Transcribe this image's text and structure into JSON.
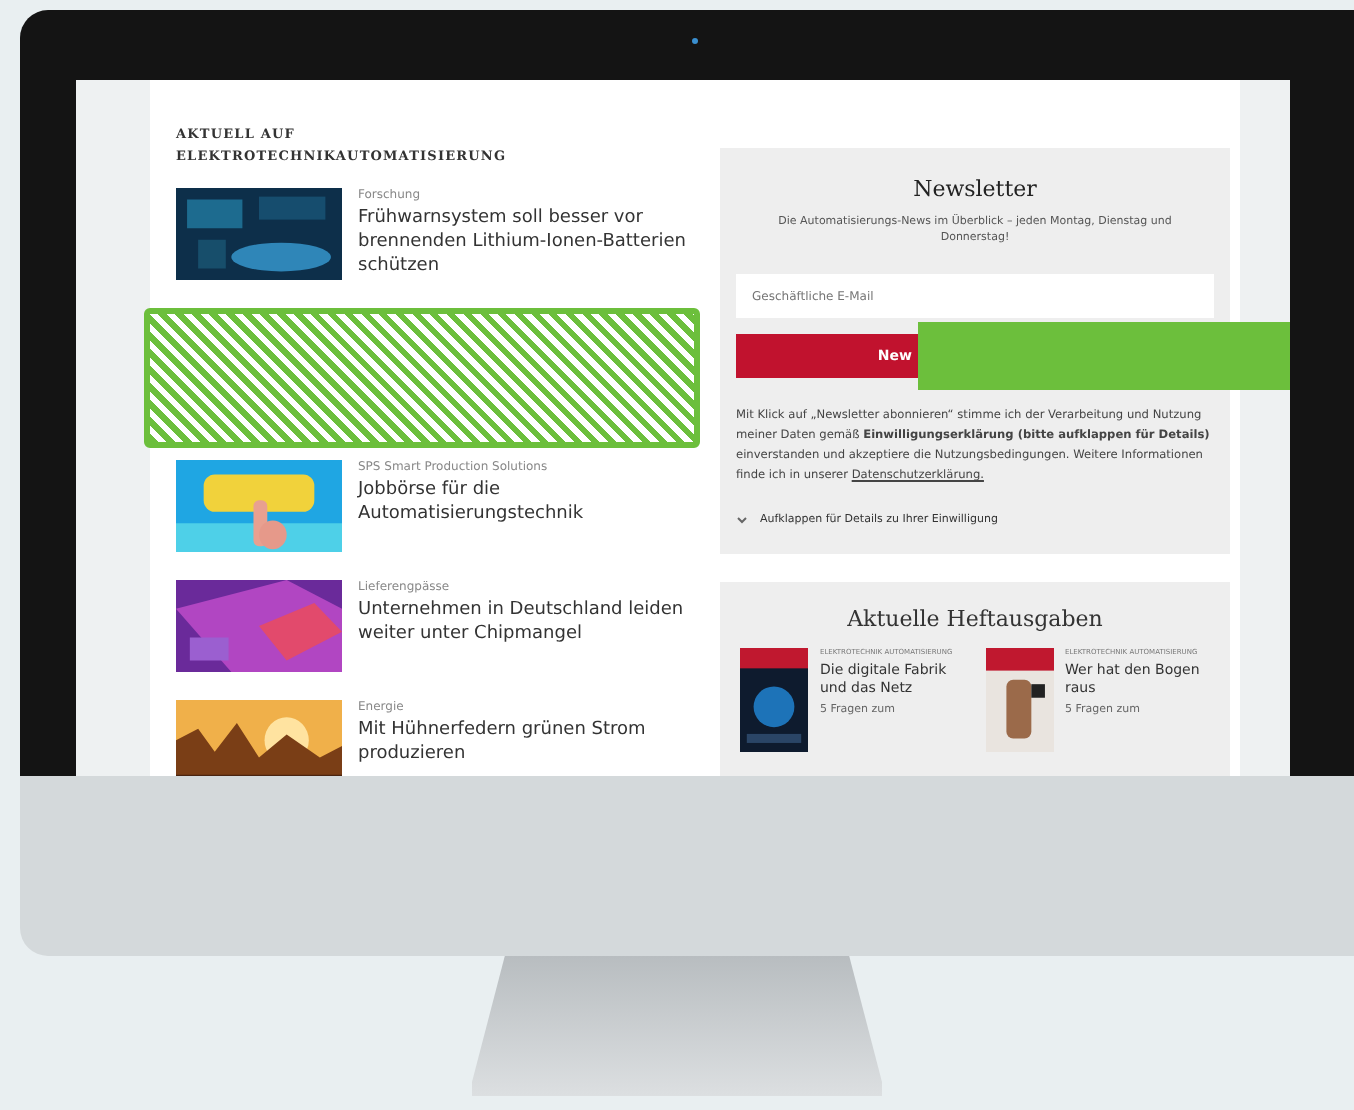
{
  "page": {
    "heading": "AKTUELL AUF ELEKTROTECHNIKAUTOMATISIERUNG",
    "articles": [
      {
        "kind": "article",
        "category": "Forschung",
        "title": "Frühwarnsystem soll besser vor brennenden Lithium-Ionen-Batterien schützen"
      },
      {
        "kind": "hatched"
      },
      {
        "kind": "article",
        "category": "SPS Smart Production Solutions",
        "title": "Jobbörse für die Automatisierungstechnik"
      },
      {
        "kind": "article",
        "category": "Lieferengpässe",
        "title": "Unternehmen in Deutschland leiden weiter unter Chipmangel"
      },
      {
        "kind": "article",
        "category": "Energie",
        "title": "Mit Hühnerfedern grünen Strom produzieren"
      }
    ],
    "newsletter": {
      "title": "Newsletter",
      "subtitle": "Die Automatisierungs-News im Überblick – jeden Montag, Dienstag und Donnerstag!",
      "email": {
        "placeholder": "Geschäftliche E-Mail"
      },
      "button": "New",
      "consent": "Mit Klick auf „Newsletter abonnieren“ stimme ich der Verarbeitung und Nutzung meiner Daten gemäß **Einwilligungserklärung (bitte aufklappen für Details)** einverstanden und akzeptiere die Nutzungsbedingungen. Weitere Informationen finde ich in unserer",
      "privacy_link": "Datenschutzerklärung.",
      "details": {
        "label": "Aufklappen für Details zu Ihrer Einwilligung",
        "expanded": false
      }
    },
    "issues": {
      "title": "Aktuelle Heftausgaben",
      "items": [
        {
          "kicker": "ELEKTROTECHNIK AUTOMATISIERUNG",
          "title": "Die digitale Fabrik und das Netz",
          "teaser": "5 Fragen zum"
        },
        {
          "kicker": "ELEKTROTECHNIK AUTOMATISIERUNG",
          "title": "Wer hat den Bogen raus",
          "teaser": "5 Fragen zum"
        }
      ]
    }
  }
}
